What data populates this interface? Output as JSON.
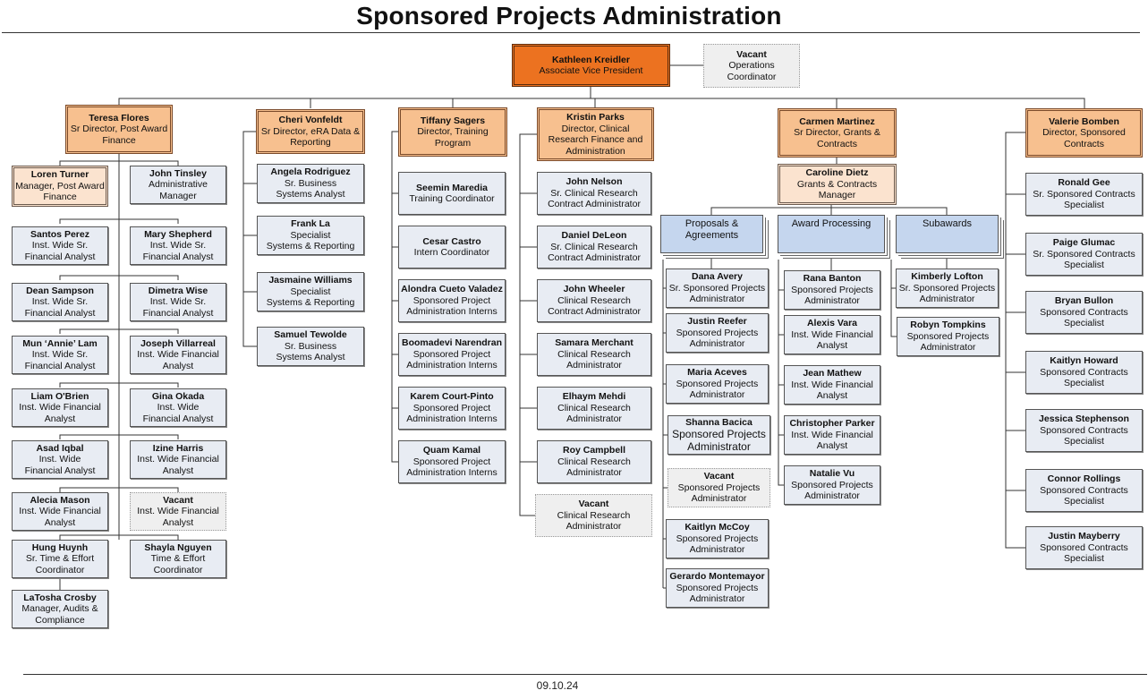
{
  "title": "Sponsored Projects Administration",
  "footer_date": "09.10.24",
  "colors": {
    "avp_fill": "#ec7220",
    "director_fill": "#f7c08f",
    "manager_fill": "#fbe3cf",
    "staff_fill": "#e8ecf3",
    "group_fill": "#c5d6ee",
    "vacant_fill": "#efefef"
  },
  "top": {
    "avp": {
      "name": "Kathleen Kreidler",
      "role": "Associate Vice President"
    },
    "ops": {
      "name": "Vacant",
      "role": "Operations\nCoordinator"
    }
  },
  "postaward": {
    "director": {
      "name": "Teresa Flores",
      "role": "Sr Director, Post Award\nFinance"
    },
    "manager": {
      "name": "Loren Turner",
      "role": "Manager, Post Award\nFinance"
    },
    "staff": [
      {
        "name": "John Tinsley",
        "role": "Administrative\nManager"
      },
      {
        "name": "Santos Perez",
        "role": "Inst. Wide Sr.\nFinancial Analyst"
      },
      {
        "name": "Mary Shepherd",
        "role": "Inst. Wide Sr.\nFinancial Analyst"
      },
      {
        "name": "Dean Sampson",
        "role": "Inst. Wide Sr.\nFinancial Analyst"
      },
      {
        "name": "Dimetra Wise",
        "role": "Inst. Wide Sr.\nFinancial Analyst"
      },
      {
        "name": "Mun ‘Annie’ Lam",
        "role": "Inst. Wide Sr.\nFinancial Analyst"
      },
      {
        "name": "Joseph Villarreal",
        "role": "Inst. Wide Financial\nAnalyst"
      },
      {
        "name": "Liam O'Brien",
        "role": "Inst. Wide Financial\nAnalyst"
      },
      {
        "name": "Gina Okada",
        "role": "Inst. Wide\nFinancial Analyst"
      },
      {
        "name": "Asad Iqbal",
        "role": "Inst. Wide\nFinancial Analyst"
      },
      {
        "name": "Izine Harris",
        "role": "Inst. Wide Financial\nAnalyst"
      },
      {
        "name": "Alecia Mason",
        "role": "Inst. Wide Financial\nAnalyst"
      },
      {
        "name": "Vacant",
        "role": "Inst. Wide Financial\nAnalyst"
      },
      {
        "name": "Hung Huynh",
        "role": "Sr. Time & Effort\nCoordinator"
      },
      {
        "name": "Shayla Nguyen",
        "role": "Time & Effort\nCoordinator"
      },
      {
        "name": "LaTosha Crosby",
        "role": "Manager, Audits &\nCompliance"
      }
    ]
  },
  "era": {
    "director": {
      "name": "Cheri Vonfeldt",
      "role": "Sr Director, eRA Data &\nReporting"
    },
    "staff": [
      {
        "name": "Angela Rodriguez",
        "role": "Sr. Business\nSystems Analyst"
      },
      {
        "name": "Frank La",
        "role": "Specialist\nSystems & Reporting"
      },
      {
        "name": "Jasmaine Williams",
        "role": "Specialist\nSystems & Reporting"
      },
      {
        "name": "Samuel Tewolde",
        "role": "Sr. Business\nSystems Analyst"
      }
    ]
  },
  "training": {
    "director": {
      "name": "Tiffany Sagers",
      "role": "Director, Training\nProgram"
    },
    "staff": [
      {
        "name": "Seemin Maredia",
        "role": "Training Coordinator"
      },
      {
        "name": "Cesar Castro",
        "role": "Intern Coordinator"
      },
      {
        "name": "Alondra Cueto Valadez",
        "role": "Sponsored Project\nAdministration Interns"
      },
      {
        "name": "Boomadevi Narendran",
        "role": "Sponsored Project\nAdministration Interns"
      },
      {
        "name": "Karem Court-Pinto",
        "role": "Sponsored Project\nAdministration Interns"
      },
      {
        "name": "Quam Kamal",
        "role": "Sponsored Project\nAdministration Interns"
      }
    ]
  },
  "clinical": {
    "director": {
      "name": "Kristin Parks",
      "role": "Director, Clinical\nResearch Finance and\nAdministration"
    },
    "staff": [
      {
        "name": "John Nelson",
        "role": "Sr. Clinical Research\nContract Administrator"
      },
      {
        "name": "Daniel DeLeon",
        "role": "Sr. Clinical Research\nContract Administrator"
      },
      {
        "name": "John Wheeler",
        "role": "Clinical Research\nContract Administrator"
      },
      {
        "name": "Samara Merchant",
        "role": "Clinical Research\nAdministrator"
      },
      {
        "name": "Elhaym Mehdi",
        "role": "Clinical Research\nAdministrator"
      },
      {
        "name": "Roy Campbell",
        "role": "Clinical Research\nAdministrator"
      },
      {
        "name": "Vacant",
        "role": "Clinical Research\nAdministrator"
      }
    ]
  },
  "grants": {
    "director": {
      "name": "Carmen Martinez",
      "role": "Sr Director, Grants &\nContracts"
    },
    "manager": {
      "name": "Caroline Dietz",
      "role": "Grants & Contracts\nManager"
    },
    "groups": [
      {
        "label": "Proposals &\nAgreements",
        "staff": [
          {
            "name": "Dana Avery",
            "role": "Sr. Sponsored Projects\nAdministrator"
          },
          {
            "name": "Justin Reefer",
            "role": "Sponsored Projects\nAdministrator"
          },
          {
            "name": "Maria Aceves",
            "role": "Sponsored Projects\nAdministrator"
          },
          {
            "name": "Shanna Bacica",
            "role": "Sponsored Projects\nAdministrator"
          },
          {
            "name": "Vacant",
            "role": "Sponsored Projects\nAdministrator"
          },
          {
            "name": "Kaitlyn McCoy",
            "role": "Sponsored Projects\nAdministrator"
          },
          {
            "name": "Gerardo Montemayor",
            "role": "Sponsored Projects\nAdministrator"
          }
        ]
      },
      {
        "label": "Award Processing",
        "staff": [
          {
            "name": "Rana Banton",
            "role": "Sponsored Projects\nAdministrator"
          },
          {
            "name": "Alexis Vara",
            "role": "Inst. Wide Financial\nAnalyst"
          },
          {
            "name": "Jean Mathew",
            "role": "Inst. Wide Financial\nAnalyst"
          },
          {
            "name": "Christopher Parker",
            "role": "Inst. Wide Financial\nAnalyst"
          },
          {
            "name": "Natalie Vu",
            "role": "Sponsored Projects\nAdministrator"
          }
        ]
      },
      {
        "label": "Subawards",
        "staff": [
          {
            "name": "Kimberly Lofton",
            "role": "Sr. Sponsored Projects\nAdministrator"
          },
          {
            "name": "Robyn Tompkins",
            "role": "Sponsored Projects\nAdministrator"
          }
        ]
      }
    ]
  },
  "contracts": {
    "director": {
      "name": "Valerie Bomben",
      "role": "Director, Sponsored\nContracts"
    },
    "staff": [
      {
        "name": "Ronald Gee",
        "role": "Sr. Sponsored Contracts\nSpecialist"
      },
      {
        "name": "Paige Glumac",
        "role": "Sr. Sponsored Contracts\nSpecialist"
      },
      {
        "name": "Bryan Bullon",
        "role": "Sponsored Contracts\nSpecialist"
      },
      {
        "name": "Kaitlyn Howard",
        "role": "Sponsored Contracts\nSpecialist"
      },
      {
        "name": "Jessica Stephenson",
        "role": "Sponsored Contracts\nSpecialist"
      },
      {
        "name": "Connor Rollings",
        "role": "Sponsored Contracts\nSpecialist"
      },
      {
        "name": "Justin Mayberry",
        "role": "Sponsored Contracts\nSpecialist"
      }
    ]
  }
}
